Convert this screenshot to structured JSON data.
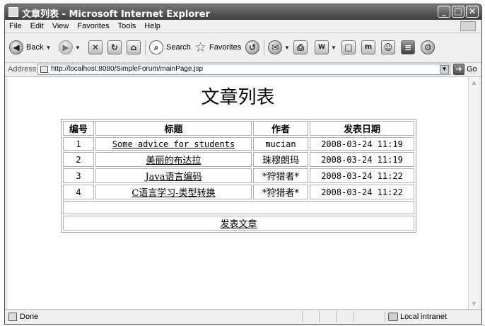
{
  "window": {
    "title": "文章列表 - Microsoft Internet Explorer"
  },
  "menu": {
    "items": [
      "File",
      "Edit",
      "View",
      "Favorites",
      "Tools",
      "Help"
    ]
  },
  "toolbar": {
    "back_label": "Back",
    "search_label": "Search",
    "favorites_label": "Favorites"
  },
  "address": {
    "label": "Address",
    "url": "http://localhost:8080/SimpleForum/mainPage.jsp",
    "go_label": "Go"
  },
  "page": {
    "title": "文章列表",
    "headers": [
      "编号",
      "标题",
      "作者",
      "发表日期"
    ],
    "rows": [
      {
        "id": "1",
        "title": "Some advice for students",
        "author": "mucian",
        "date": "2008-03-24 11:19"
      },
      {
        "id": "2",
        "title": "美丽的布达拉",
        "author": "珠穆朗玛",
        "date": "2008-03-24 11:19"
      },
      {
        "id": "3",
        "title": "Java语言编码",
        "author": "*狩猎者*",
        "date": "2008-03-24 11:22"
      },
      {
        "id": "4",
        "title": "C语言学习-类型转换",
        "author": "*狩猎者*",
        "date": "2008-03-24 11:22"
      }
    ],
    "post_link": "发表文章"
  },
  "status": {
    "text": "Done",
    "zone": "Local intranet"
  },
  "icons": [
    "app-icon",
    "back-icon",
    "forward-icon",
    "stop-icon",
    "refresh-icon",
    "home-icon",
    "search-icon",
    "favorites-star-icon",
    "history-icon",
    "mail-icon",
    "print-icon",
    "edit-icon",
    "discuss-icon",
    "messenger-icon",
    "page-icon",
    "go-arrow-icon",
    "done-icon",
    "intranet-icon",
    "windows-logo-icon"
  ]
}
